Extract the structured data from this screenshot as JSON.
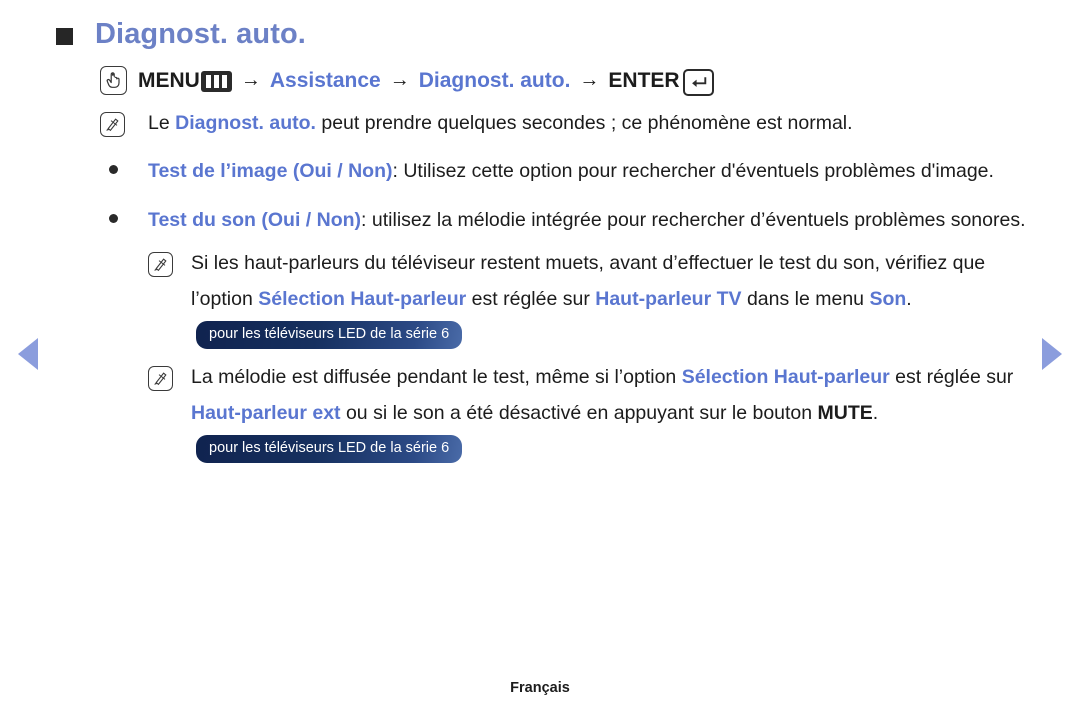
{
  "page": {
    "title": "Diagnost. auto.",
    "footer_language": "Français"
  },
  "nav": {
    "prev_label": "◀",
    "next_label": "▶"
  },
  "menu_path": {
    "hand_icon": "hand-press-icon",
    "menu_label": "MENU",
    "menu_icon": "menu-bars-icon",
    "arrow1": "→",
    "step1": "Assistance",
    "arrow2": "→",
    "step2": "Diagnost. auto.",
    "arrow3": "→",
    "enter_label": "ENTER",
    "enter_icon": "enter-key-icon"
  },
  "notes": {
    "note1": {
      "icon": "note-pencil-icon",
      "part1": "Le ",
      "highlight1": "Diagnost. auto.",
      "part2": " peut prendre quelques secondes ; ce phénomène est normal."
    },
    "note2": {
      "icon": "note-pencil-icon",
      "part1": "Si les haut-parleurs du téléviseur restent muets, avant d’effectuer le test du son, vérifiez que l’option ",
      "highlight1": "Sélection Haut-parleur",
      "part2": " est réglée sur ",
      "highlight2": "Haut-parleur TV",
      "part3": " dans le menu ",
      "highlight3": "Son",
      "part4": ".",
      "badge": "pour les téléviseurs LED de la série 6"
    },
    "note3": {
      "icon": "note-pencil-icon",
      "part1": "La mélodie est diffusée pendant le test, même si l’option ",
      "highlight1": "Sélection Haut-parleur",
      "part2": " est réglée sur ",
      "highlight2": "Haut-parleur ext",
      "part3": " ou si le son a été désactivé en appuyant sur le bouton ",
      "highlight3": "MUTE",
      "part4": ".",
      "badge": "pour les téléviseurs LED de la série 6"
    }
  },
  "bullets": [
    {
      "term": "Test de l’image (Oui / Non)",
      "separator": ":",
      "description": " Utilisez cette option pour rechercher d'éventuels problèmes d'image."
    },
    {
      "term": "Test du son (Oui / Non)",
      "separator": ":",
      "description": " utilisez la mélodie intégrée pour rechercher d’éventuels problèmes sonores."
    }
  ],
  "colors": {
    "title_blue": "#6c81c6",
    "term_blue": "#5a76d0",
    "arrow_blue": "#8b9ddd",
    "badge_navy": "#16305f",
    "text_black": "#1c1c1c"
  }
}
